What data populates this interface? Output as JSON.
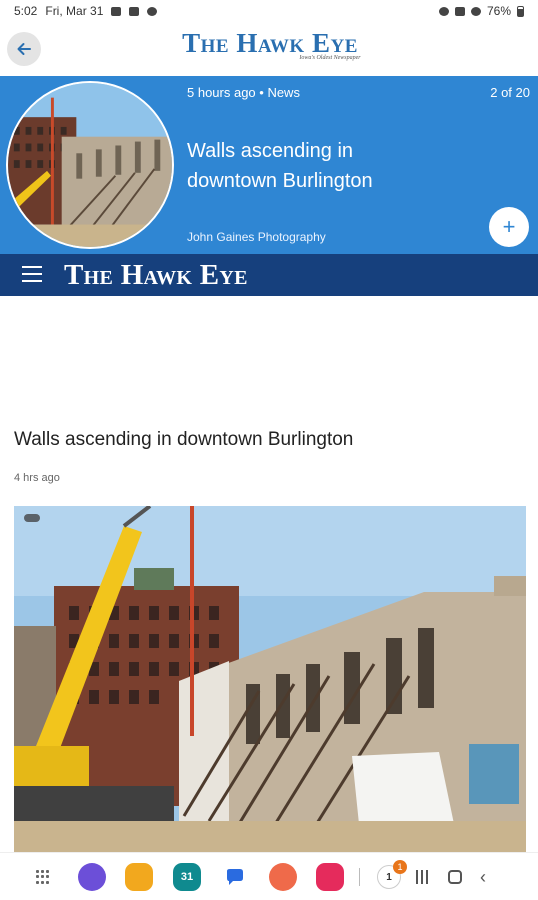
{
  "status_bar": {
    "time": "5:02",
    "date": "Fri, Mar 31",
    "battery": "76%"
  },
  "app_header": {
    "logo": "The Hawk Eye",
    "tagline": "Iowa's Oldest Newspaper"
  },
  "story": {
    "meta": "5 hours ago • News",
    "position": "2 of 20",
    "title": "Walls ascending in downtown Burlington",
    "credit": "John Gaines Photography",
    "add_label": "+"
  },
  "site_nav": {
    "logo": "The Hawk Eye"
  },
  "article": {
    "title": "Walls ascending in downtown Burlington",
    "timestamp": "4 hrs ago"
  },
  "dock": {
    "calendar_day": "31",
    "recent_badge": "1"
  },
  "colors": {
    "story_header_bg": "#2f86d3",
    "nav_bg": "#16407d",
    "logo_blue": "#2a6fb0"
  }
}
